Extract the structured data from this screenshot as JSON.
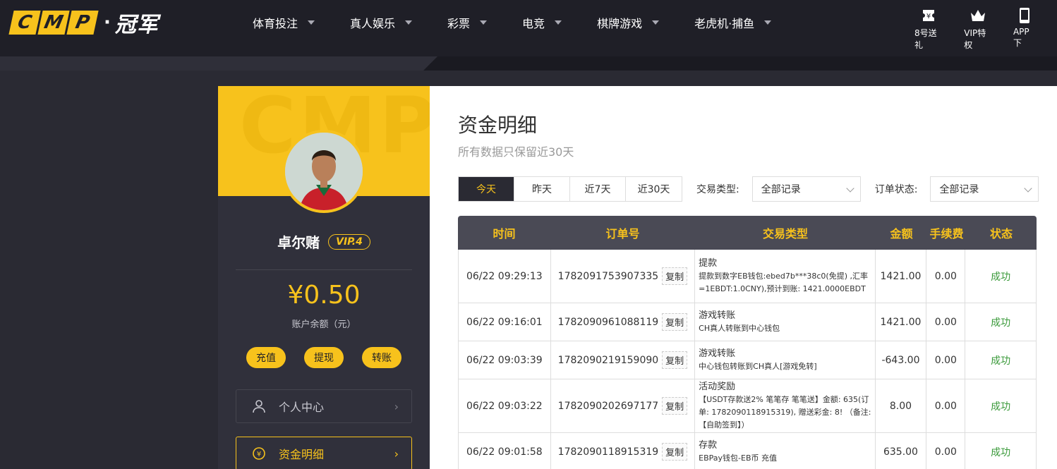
{
  "header": {
    "logo_letters": [
      "C",
      "M",
      "P"
    ],
    "logo_cn": "冠军",
    "nav": [
      {
        "label": "体育投注"
      },
      {
        "label": "真人娱乐"
      },
      {
        "label": "彩票"
      },
      {
        "label": "电竞"
      },
      {
        "label": "棋牌游戏"
      },
      {
        "label": "老虎机·捕鱼"
      }
    ],
    "right_icons": [
      {
        "label": "8号送礼",
        "icon": "ticket-icon"
      },
      {
        "label": "VIP特权",
        "icon": "crown-icon"
      },
      {
        "label": "APP下",
        "icon": "phone-icon"
      }
    ]
  },
  "sidebar": {
    "username": "卓尔赌",
    "vip": "VIP.4",
    "balance": "¥0.50",
    "balance_label": "账户余额（元）",
    "buttons": [
      "充值",
      "提现",
      "转账"
    ],
    "menu": [
      {
        "label": "个人中心",
        "icon": "user-icon",
        "active": false
      },
      {
        "label": "资金明细",
        "icon": "coin-icon",
        "active": true
      }
    ]
  },
  "main": {
    "title": "资金明细",
    "subtitle": "所有数据只保留近30天",
    "range_tabs": [
      "今天",
      "昨天",
      "近7天",
      "近30天"
    ],
    "active_range": "今天",
    "type_label": "交易类型:",
    "type_value": "全部记录",
    "status_label": "订单状态:",
    "status_value": "全部记录",
    "columns": [
      "时间",
      "订单号",
      "交易类型",
      "金额",
      "手续费",
      "状态"
    ],
    "copy_label": "复制",
    "rows": [
      {
        "time": "06/22 09:29:13",
        "order": "1782091753907335",
        "type": "提款",
        "desc": "提款到数字EB钱包:ebed7b***38c0(免提) ,汇率=1EBDT:1.0CNY),预计到账: 1421.0000EBDT",
        "amount": "1421.00",
        "fee": "0.00",
        "status": "成功"
      },
      {
        "time": "06/22 09:16:01",
        "order": "1782090961088119",
        "type": "游戏转账",
        "desc": "CH真人转账到中心钱包",
        "amount": "1421.00",
        "fee": "0.00",
        "status": "成功"
      },
      {
        "time": "06/22 09:03:39",
        "order": "1782090219159090",
        "type": "游戏转账",
        "desc": "中心钱包转账到CH真人[游戏免转]",
        "amount": "-643.00",
        "fee": "0.00",
        "status": "成功"
      },
      {
        "time": "06/22 09:03:22",
        "order": "1782090202697177",
        "type": "活动奖励",
        "desc": "【USDT存款送2% 笔笔存 笔笔送】金额: 635(订单: 1782090118915319), 赠送彩金: 8! （备注: 【自助签到】）",
        "amount": "8.00",
        "fee": "0.00",
        "status": "成功"
      },
      {
        "time": "06/22 09:01:58",
        "order": "1782090118915319",
        "type": "存款",
        "desc": "EBPay钱包-EB币 充值",
        "amount": "635.00",
        "fee": "0.00",
        "status": "成功"
      }
    ]
  }
}
